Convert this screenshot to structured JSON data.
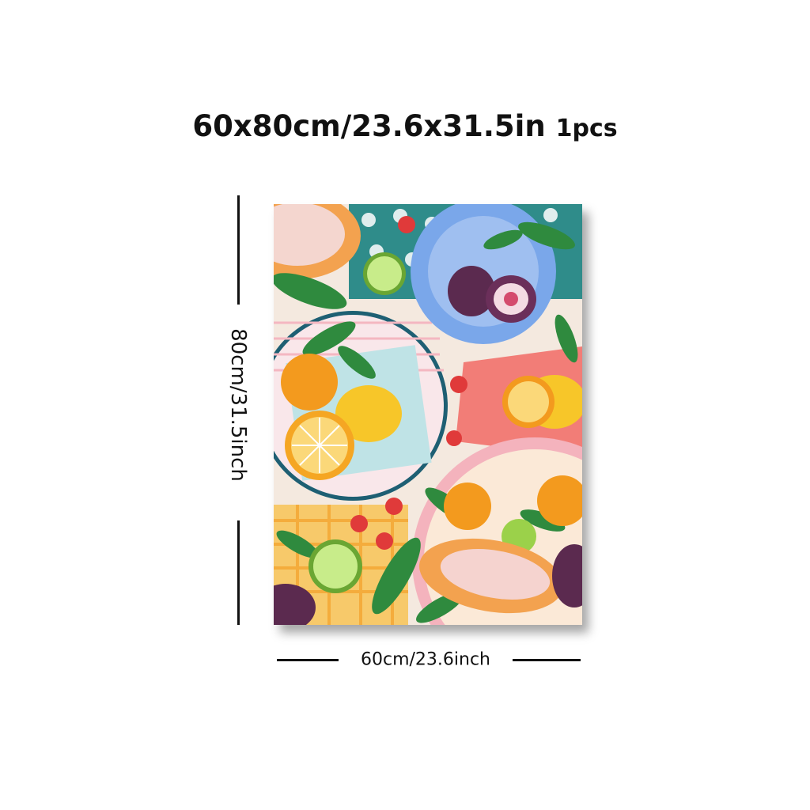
{
  "header": {
    "size_title": "60x80cm/23.6x31.5in",
    "quantity": "1pcs"
  },
  "dimensions": {
    "height_label": "80cm/31.5inch",
    "width_label": "60cm/23.6inch"
  },
  "artwork": {
    "subject": "fruit-platter-illustration",
    "colors": {
      "blue_plate": "#7aa7ea",
      "pink_plate": "#f7c9cf",
      "teal_tile": "#2f8c8a",
      "orange": "#f39a1e",
      "lemon": "#f7c629",
      "lime": "#9bd14a",
      "fig": "#5b2a4f",
      "papaya": "#f3a24f",
      "leaf": "#2f8a3e",
      "strawberry": "#e03a3a"
    }
  }
}
